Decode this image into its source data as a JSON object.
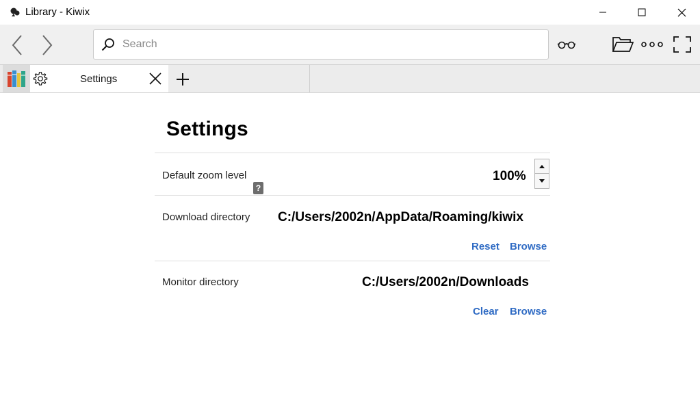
{
  "window": {
    "title": "Library - Kiwix",
    "controls": {
      "minimize": "minimize-icon",
      "maximize": "maximize-icon",
      "close": "close-icon"
    }
  },
  "toolbar": {
    "back_icon": "chevron-left-icon",
    "forward_icon": "chevron-right-icon",
    "search": {
      "placeholder": "Search",
      "value": ""
    },
    "buttons": [
      "reading-glasses-icon",
      "folder-open-icon",
      "more-dots-icon",
      "fullscreen-icon"
    ]
  },
  "tabs": {
    "library_icon": "books-icon",
    "items": [
      {
        "label": "Settings",
        "icon": "gear-icon"
      }
    ],
    "new_tab_icon": "plus-icon"
  },
  "settings": {
    "title": "Settings",
    "zoom": {
      "label": "Default zoom level",
      "value": "100%"
    },
    "download": {
      "label": "Download directory",
      "value": "C:/Users/2002n/AppData/Roaming/kiwix",
      "reset": "Reset",
      "browse": "Browse"
    },
    "monitor": {
      "label": "Monitor directory",
      "help": "?",
      "value": "C:/Users/2002n/Downloads",
      "clear": "Clear",
      "browse": "Browse"
    }
  },
  "colors": {
    "link": "#2f6bc4",
    "toolbar_bg": "#f0f0f0",
    "tabbar_bg": "#ececec"
  }
}
